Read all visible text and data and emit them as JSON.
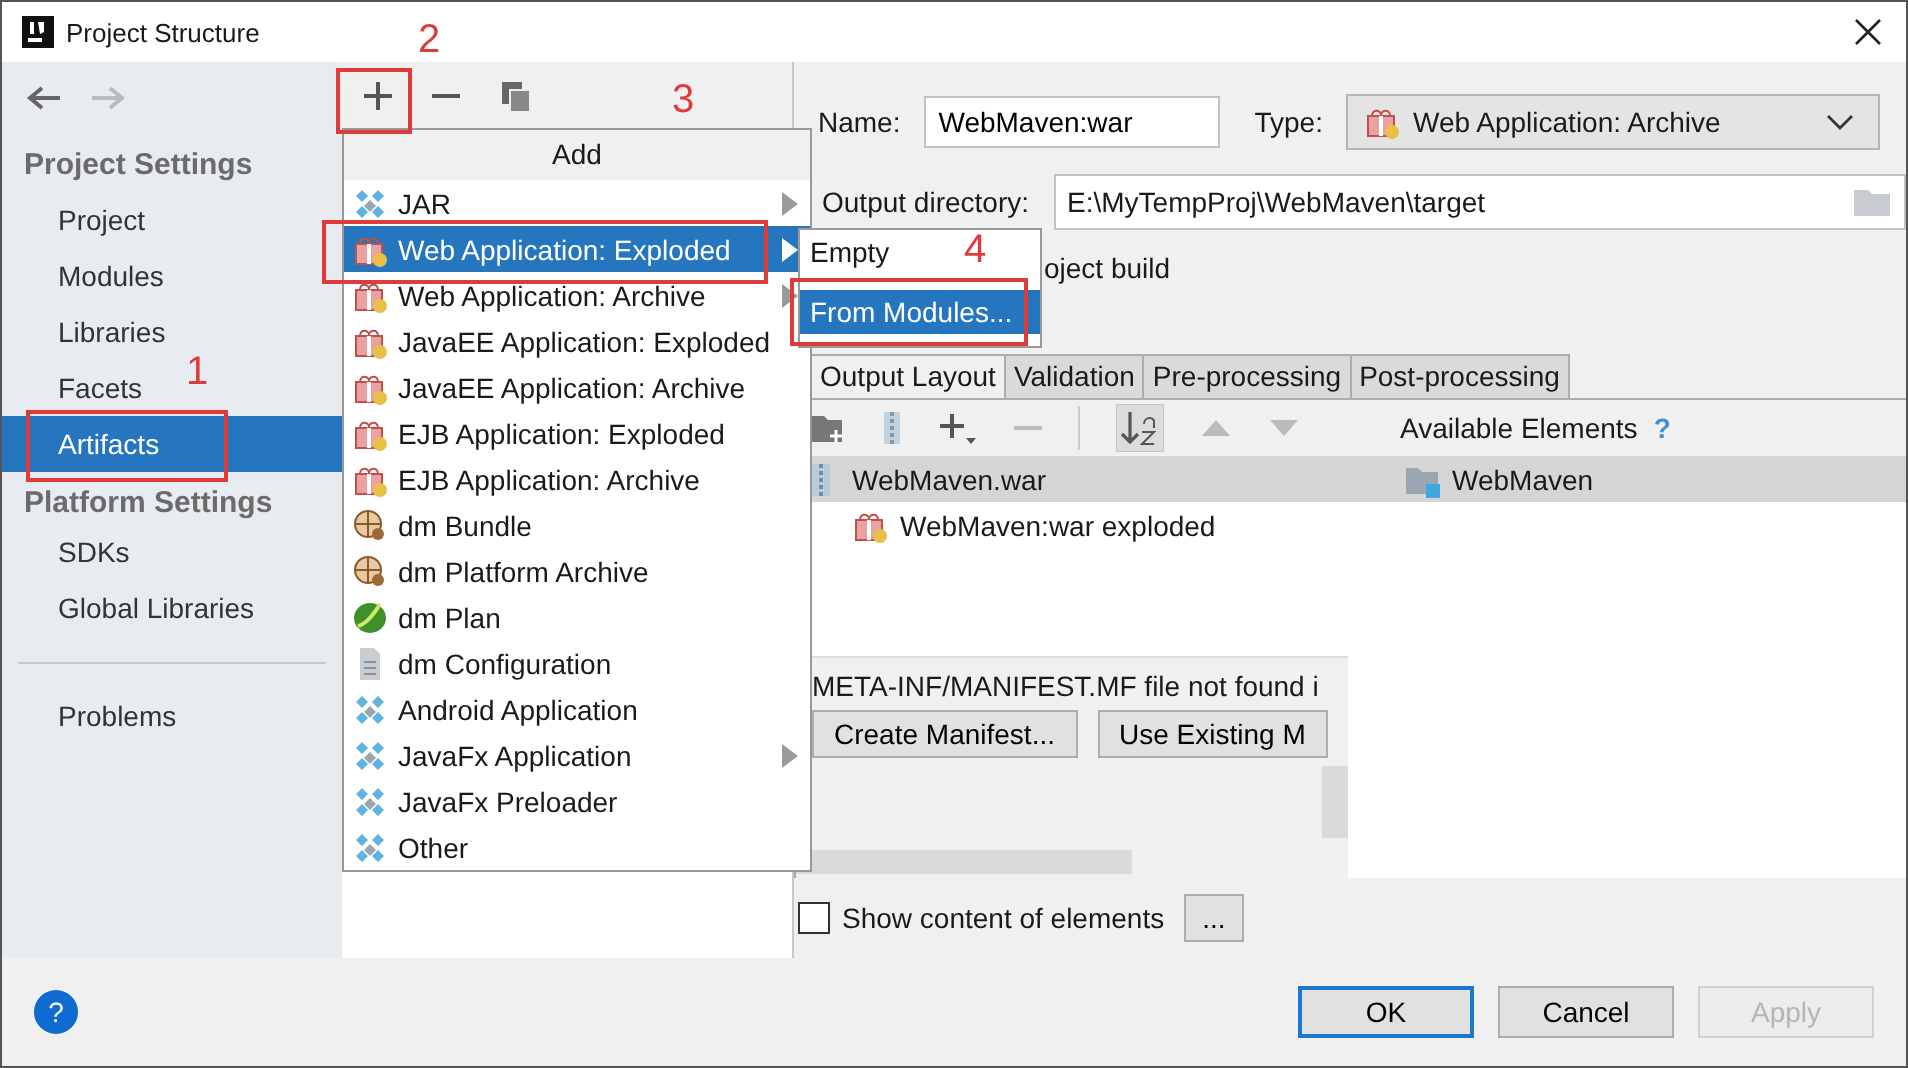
{
  "window": {
    "title": "Project Structure"
  },
  "sidebar": {
    "sections": [
      {
        "heading": "Project Settings",
        "items": [
          {
            "label": "Project",
            "selected": false
          },
          {
            "label": "Modules",
            "selected": false
          },
          {
            "label": "Libraries",
            "selected": false
          },
          {
            "label": "Facets",
            "selected": false
          },
          {
            "label": "Artifacts",
            "selected": true
          }
        ]
      },
      {
        "heading": "Platform Settings",
        "items": [
          {
            "label": "SDKs",
            "selected": false
          },
          {
            "label": "Global Libraries",
            "selected": false
          }
        ]
      }
    ],
    "extra_items": [
      {
        "label": "Problems",
        "selected": false
      }
    ]
  },
  "add_menu": {
    "title": "Add",
    "items": [
      {
        "label": "JAR",
        "kind": "diamond",
        "submenu": true,
        "selected": false
      },
      {
        "label": "Web Application: Exploded",
        "kind": "gift",
        "submenu": true,
        "selected": true
      },
      {
        "label": "Web Application: Archive",
        "kind": "gift",
        "submenu": true,
        "selected": false
      },
      {
        "label": "JavaEE Application: Exploded",
        "kind": "gift",
        "submenu": false,
        "selected": false
      },
      {
        "label": "JavaEE Application: Archive",
        "kind": "gift",
        "submenu": false,
        "selected": false
      },
      {
        "label": "EJB Application: Exploded",
        "kind": "gift",
        "submenu": false,
        "selected": false
      },
      {
        "label": "EJB Application: Archive",
        "kind": "gift",
        "submenu": false,
        "selected": false
      },
      {
        "label": "dm Bundle",
        "kind": "bundle",
        "submenu": false,
        "selected": false
      },
      {
        "label": "dm Platform Archive",
        "kind": "bundle",
        "submenu": false,
        "selected": false
      },
      {
        "label": "dm Plan",
        "kind": "leaf",
        "submenu": false,
        "selected": false
      },
      {
        "label": "dm Configuration",
        "kind": "sheet",
        "submenu": false,
        "selected": false
      },
      {
        "label": "Android Application",
        "kind": "diamond",
        "submenu": false,
        "selected": false
      },
      {
        "label": "JavaFx Application",
        "kind": "diamond",
        "submenu": true,
        "selected": false
      },
      {
        "label": "JavaFx Preloader",
        "kind": "diamond",
        "submenu": false,
        "selected": false
      },
      {
        "label": "Other",
        "kind": "diamond",
        "submenu": false,
        "selected": false
      }
    ]
  },
  "submenu": {
    "items": [
      {
        "label": "Empty",
        "selected": false
      },
      {
        "label": "From Modules...",
        "selected": true
      }
    ]
  },
  "artifact": {
    "name_label": "Name:",
    "name": "WebMaven:war",
    "type_label": "Type:",
    "type": "Web Application: Archive",
    "output_label": "Output directory:",
    "output": "E:\\MyTempProj\\WebMaven\\target",
    "build_label": "oject build"
  },
  "tabs": [
    {
      "label": "Output Layout",
      "selected": true
    },
    {
      "label": "Validation",
      "selected": false
    },
    {
      "label": "Pre-processing",
      "selected": false
    },
    {
      "label": "Post-processing",
      "selected": false
    }
  ],
  "layout": {
    "available_label": "Available Elements",
    "help": "?",
    "tree": [
      {
        "label": "WebMaven.war",
        "kind": "archive",
        "selected": true,
        "children": [
          {
            "label": "WebMaven:war exploded",
            "kind": "gift",
            "selected": false
          }
        ]
      }
    ],
    "available": [
      {
        "label": "WebMaven",
        "kind": "module",
        "selected": true
      }
    ],
    "message": "META-INF/MANIFEST.MF file not found i",
    "buttons": [
      "Create Manifest...",
      "Use Existing M"
    ]
  },
  "show_content": {
    "label": "Show content of elements",
    "checked": false
  },
  "more_button": "...",
  "help_button": "?",
  "buttons": [
    {
      "label": "OK",
      "default": true,
      "disabled": false
    },
    {
      "label": "Cancel",
      "default": false,
      "disabled": false
    },
    {
      "label": "Apply",
      "default": false,
      "disabled": true
    }
  ],
  "annotations": [
    {
      "label": "1"
    },
    {
      "label": "2"
    },
    {
      "label": "3"
    },
    {
      "label": "4"
    }
  ]
}
